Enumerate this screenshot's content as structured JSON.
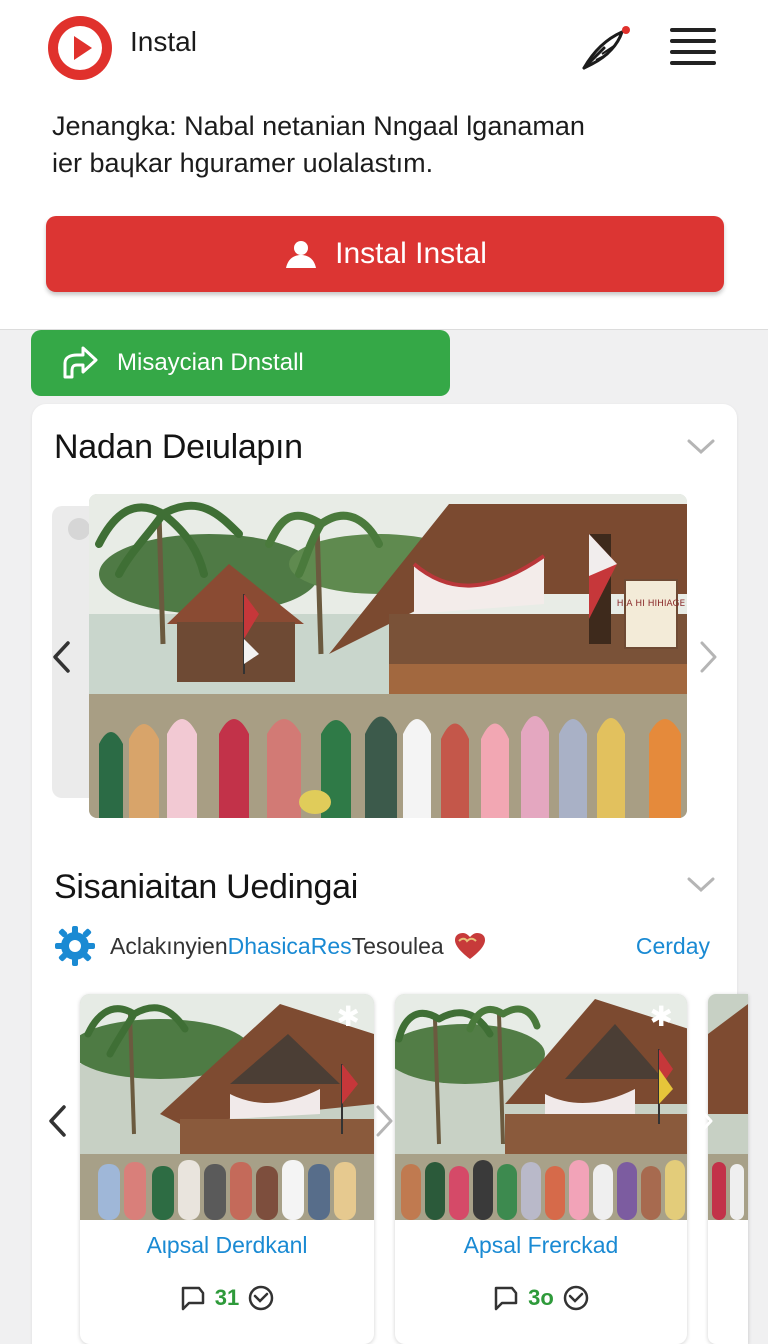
{
  "app": {
    "title": "Instal",
    "logo_icon": "play-logo-icon",
    "feather_icon": "feather-icon",
    "menu_icon": "hamburger-menu-icon",
    "accent": "#dc3533"
  },
  "intro": {
    "line1": "Jenangka: Nabal netanian Nngaal lganaman",
    "line2": "ier baɥkar hguramer uolalastım."
  },
  "install_button": {
    "label": "Instal Instal",
    "icon": "person-icon",
    "color": "#dc3533"
  },
  "secondary_button": {
    "label": "Misaycian Dnstall",
    "icon": "share-icon",
    "color": "#35a847"
  },
  "section1": {
    "title": "Nadan Deιulapın",
    "chevron": "chevron-down-icon",
    "hero": {
      "image": "village-gathering-photo",
      "sign": "H A HI HIHIAGE"
    }
  },
  "section2": {
    "title": "Sisaniaitan Uedingai",
    "chevron": "chevron-down-icon",
    "tags": {
      "icon": "gear-icon",
      "part1": "Aclakınyien ",
      "highlight": "DhasicaRes",
      "part2": " Tesoulea",
      "heart_icon": "heart-icon",
      "action": "Cerday"
    },
    "items": [
      {
        "title": "Aιpsal Derdkanl",
        "count": "31",
        "badge": "✱"
      },
      {
        "title": "Apsal Frerckad",
        "count": "3o",
        "badge": "✱"
      }
    ]
  }
}
